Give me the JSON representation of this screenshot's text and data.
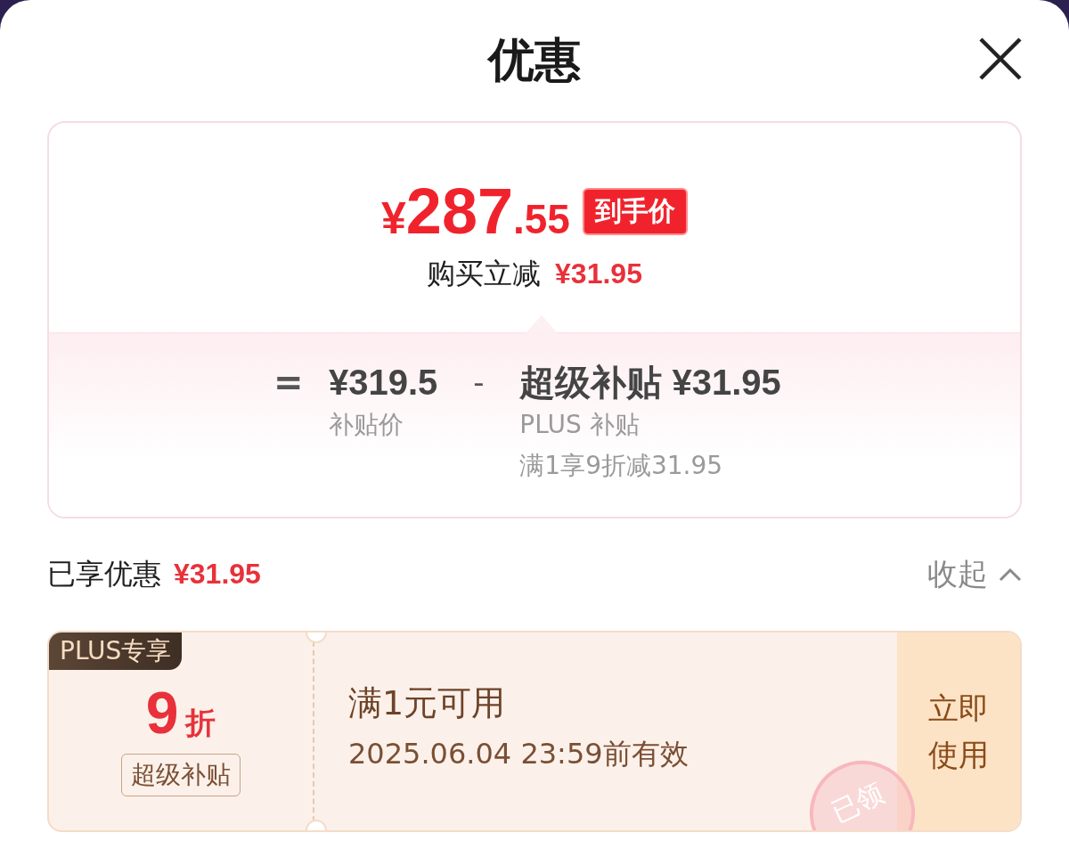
{
  "sheet": {
    "title": "优惠"
  },
  "summary": {
    "currency": "¥",
    "price_int": "287",
    "price_dec": ".55",
    "price_badge": "到手价",
    "reduce_label": "购买立减",
    "reduce_amount": "¥31.95",
    "formula": {
      "equals": "=",
      "base_price": "¥319.5",
      "base_label": "补贴价",
      "operator": "-",
      "discount_title": "超级补贴 ¥31.95",
      "discount_lines": [
        "PLUS 补贴",
        "满1享9折减31.95"
      ]
    }
  },
  "enjoyed": {
    "label": "已享优惠",
    "amount": "¥31.95",
    "toggle": "收起",
    "expanded": true
  },
  "coupons": [
    {
      "tag": "PLUS专享",
      "value": "9",
      "unit": "折",
      "type_label": "超级补贴",
      "condition": "满1元可用",
      "validity": "2025.06.04 23:59前有效",
      "action": "立即使用",
      "stamp": "已领"
    }
  ]
}
